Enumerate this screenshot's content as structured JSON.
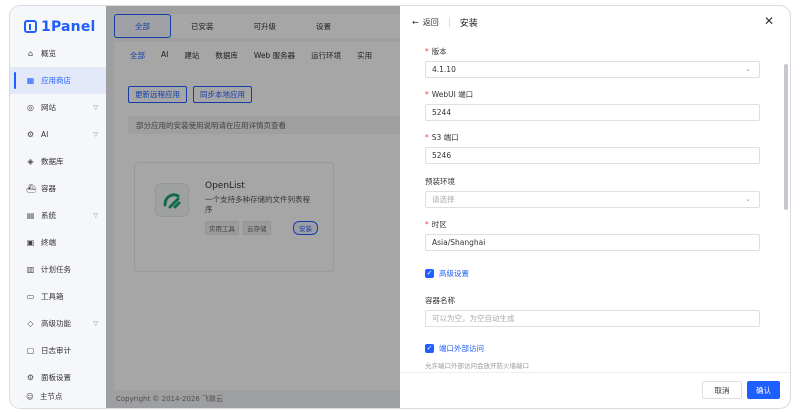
{
  "app": {
    "logo_text": "1Panel"
  },
  "sidebar": {
    "items": [
      {
        "label": "概览",
        "icon": "home-icon"
      },
      {
        "label": "应用商店",
        "icon": "grid-icon",
        "active": true
      },
      {
        "label": "网站",
        "icon": "globe-icon",
        "chevron": true
      },
      {
        "label": "AI",
        "icon": "ai-icon",
        "chevron": true
      },
      {
        "label": "数据库",
        "icon": "database-icon"
      },
      {
        "label": "容器",
        "icon": "container-icon"
      },
      {
        "label": "系统",
        "icon": "system-icon",
        "chevron": true
      },
      {
        "label": "终端",
        "icon": "terminal-icon"
      },
      {
        "label": "计划任务",
        "icon": "schedule-icon"
      },
      {
        "label": "工具箱",
        "icon": "toolbox-icon"
      },
      {
        "label": "高级功能",
        "icon": "diamond-icon",
        "chevron": true
      },
      {
        "label": "日志审计",
        "icon": "log-icon"
      },
      {
        "label": "面板设置",
        "icon": "settings-icon"
      }
    ],
    "node_label": "主节点"
  },
  "topbar": {
    "tabs": [
      "全部",
      "已安装",
      "可升级",
      "设置"
    ]
  },
  "categories": [
    "全部",
    "AI",
    "建站",
    "数据库",
    "Web 服务器",
    "运行环境",
    "实用"
  ],
  "actions": {
    "update_remote": "更新远程应用",
    "sync_local": "同步本地应用"
  },
  "notice": "部分应用的安装使用说明请在应用详情页查看",
  "app_card": {
    "name": "OpenList",
    "description": "一个支持多种存储的文件列表程序",
    "tags": [
      "实用工具",
      "云存储"
    ],
    "install_label": "安装"
  },
  "footer": {
    "copyright": "Copyright © 2014-2026 飞致云"
  },
  "drawer": {
    "back_label": "返回",
    "title": "安装",
    "fields": {
      "version": {
        "label": "版本",
        "value": "4.1.10"
      },
      "webui_port": {
        "label": "WebUI 端口",
        "value": "5244"
      },
      "s3_port": {
        "label": "S3 端口",
        "value": "5246"
      },
      "env": {
        "label": "预装环境",
        "placeholder": "请选择"
      },
      "timezone": {
        "label": "时区",
        "value": "Asia/Shanghai"
      },
      "container_name": {
        "label": "容器名称",
        "placeholder": "可以为空，为空自动生成"
      }
    },
    "advanced_label": "高级设置",
    "port_external_label": "端口外部访问",
    "port_external_hint": "允许端口外部访问会放开防火墙端口",
    "cancel_label": "取消",
    "confirm_label": "确认"
  },
  "colors": {
    "accent": "#1f5fff",
    "required": "#e54545"
  }
}
